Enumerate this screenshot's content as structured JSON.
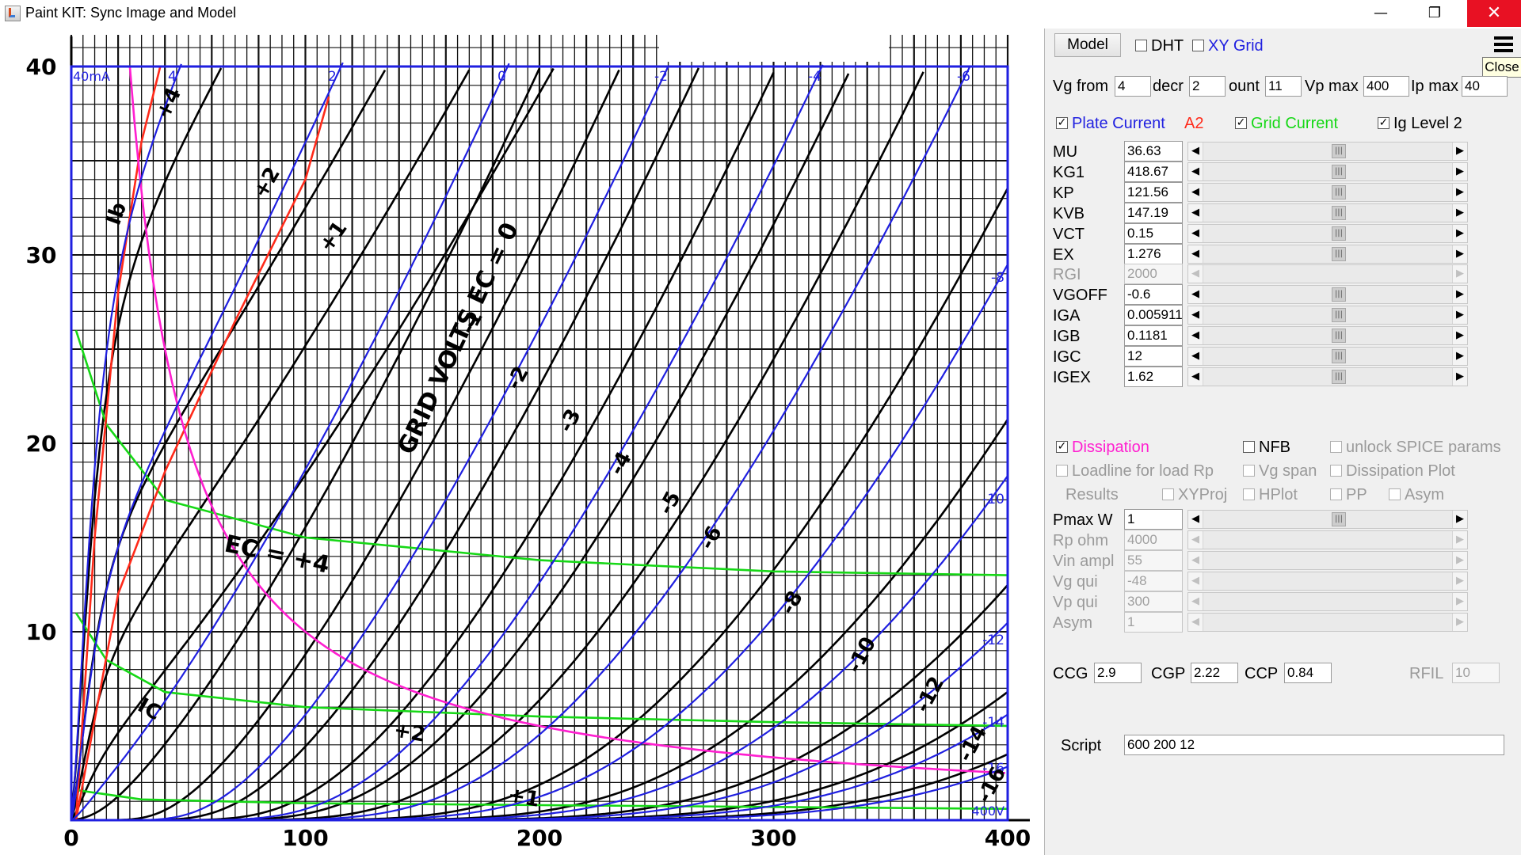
{
  "window": {
    "title": "Paint KIT: Sync Image and Model",
    "minimize_glyph": "—",
    "maximize_glyph": "❐",
    "close_glyph": "✕"
  },
  "colors": {
    "model_blue": "#1f1fe0",
    "grid_green": "#16d816",
    "a2_red": "#ff2a1a",
    "dissipation_magenta": "#ff1fd0",
    "scan_black": "#000000"
  },
  "plot": {
    "x_axis": {
      "min": 0,
      "max": 400,
      "unit": "V",
      "ticks": [
        "0",
        "100",
        "200",
        "300",
        "400"
      ]
    },
    "y_axis": {
      "min": 0,
      "max": 40,
      "unit": "mA",
      "ticks": [
        "10",
        "20",
        "30",
        "40"
      ]
    },
    "top_left_label": "40mA",
    "bottom_right_label": "400V",
    "scan_annotations": [
      "GRID VOLTS EC = 0",
      "EC = +4",
      "+2",
      "+1",
      "IC",
      "Ib",
      "+4",
      "+2",
      "+1"
    ],
    "model_curve_labels_top": [
      "4",
      "2",
      "0",
      "-2",
      "-4",
      "-6"
    ],
    "model_curve_labels_right": [
      "-8",
      "-10",
      "-12",
      "-14",
      "-16"
    ],
    "scan_curve_labels": [
      "-1",
      "-2",
      "-3",
      "-4",
      "-5",
      "-6",
      "-8",
      "-10",
      "-12",
      "-14",
      "-16"
    ]
  },
  "chart_data": {
    "type": "line",
    "xlabel": "",
    "ylabel": "",
    "xlim": [
      0,
      400
    ],
    "ylim": [
      0,
      40
    ],
    "grid": true,
    "model_params": {
      "mu": 36.63,
      "kg1": 418.67,
      "kp": 121.56,
      "kvb": 147.19,
      "ex": 1.276,
      "vct": 0.15
    },
    "plate_current_vg": [
      4,
      2,
      0,
      -2,
      -4,
      -6,
      -8,
      -10,
      -12,
      -14,
      -16
    ],
    "series": [
      {
        "name": "Vg 4",
        "kind": "plate",
        "vg": 4
      },
      {
        "name": "Vg 2",
        "kind": "plate",
        "vg": 2
      },
      {
        "name": "Vg 0",
        "kind": "plate",
        "vg": 0
      },
      {
        "name": "Vg -2",
        "kind": "plate",
        "vg": -2
      },
      {
        "name": "Vg -4",
        "kind": "plate",
        "vg": -4
      },
      {
        "name": "Vg -6",
        "kind": "plate",
        "vg": -6
      },
      {
        "name": "Vg -8",
        "kind": "plate",
        "vg": -8
      },
      {
        "name": "Vg -10",
        "kind": "plate",
        "vg": -10
      },
      {
        "name": "Vg -12",
        "kind": "plate",
        "vg": -12
      },
      {
        "name": "Vg -14",
        "kind": "plate",
        "vg": -14
      },
      {
        "name": "Vg -16",
        "kind": "plate",
        "vg": -16
      }
    ],
    "grid_current_curves": [
      {
        "vg": 4,
        "points": [
          [
            2,
            26
          ],
          [
            15,
            21
          ],
          [
            40,
            17
          ],
          [
            100,
            15
          ],
          [
            200,
            13.8
          ],
          [
            300,
            13.2
          ],
          [
            400,
            13
          ]
        ]
      },
      {
        "vg": 2,
        "points": [
          [
            2,
            11
          ],
          [
            15,
            8.5
          ],
          [
            40,
            6.8
          ],
          [
            100,
            6
          ],
          [
            200,
            5.5
          ],
          [
            300,
            5.2
          ],
          [
            400,
            5
          ]
        ]
      },
      {
        "vg": 0,
        "points": [
          [
            2,
            1.6
          ],
          [
            30,
            1.1
          ],
          [
            100,
            0.9
          ],
          [
            200,
            0.8
          ],
          [
            300,
            0.7
          ],
          [
            400,
            0.6
          ]
        ]
      }
    ],
    "a2_curves": [
      {
        "vg": 4,
        "points": [
          [
            2,
            0
          ],
          [
            10,
            15
          ],
          [
            20,
            28
          ],
          [
            30,
            36
          ],
          [
            38,
            40
          ]
        ]
      },
      {
        "vg": 2,
        "points": [
          [
            2,
            0
          ],
          [
            20,
            12
          ],
          [
            40,
            18.5
          ],
          [
            70,
            26.5
          ],
          [
            100,
            34
          ],
          [
            110,
            38.4
          ]
        ]
      }
    ],
    "dissipation_pmax_w": 1
  },
  "panel": {
    "model_button": "Model",
    "dht_label": "DHT",
    "xy_grid_label": "XY Grid",
    "close_tooltip": "Close",
    "vg_from_label": "Vg from",
    "vg_from_value": "4",
    "decr_label": "decr",
    "decr_value": "2",
    "count_label": "ount",
    "count_value": "11",
    "vp_max_label": "Vp max",
    "vp_max_value": "400",
    "ip_max_label": "Ip max",
    "ip_max_value": "40",
    "plate_current_label": "Plate Current",
    "a2_label": "A2",
    "grid_current_label": "Grid Current",
    "ig_level_label": "Ig Level 2",
    "params": [
      {
        "name": "MU",
        "value": "36.63"
      },
      {
        "name": "KG1",
        "value": "418.67"
      },
      {
        "name": "KP",
        "value": "121.56"
      },
      {
        "name": "KVB",
        "value": "147.19"
      },
      {
        "name": "VCT",
        "value": "0.15"
      },
      {
        "name": "EX",
        "value": "1.276"
      },
      {
        "name": "RGI",
        "value": "2000"
      },
      {
        "name": "VGOFF",
        "value": "-0.6"
      },
      {
        "name": "IGA",
        "value": "0.005911"
      },
      {
        "name": "IGB",
        "value": "0.1181"
      },
      {
        "name": "IGC",
        "value": "12"
      },
      {
        "name": "IGEX",
        "value": "1.62"
      }
    ],
    "dissipation_label": "Dissipation",
    "nfb_label": "NFB",
    "unlock_spice_label": "unlock SPICE params",
    "loadline_label": "Loadline for load Rp",
    "vg_span_label": "Vg span",
    "dissipation_plot_label": "Dissipation Plot",
    "results_label": "Results",
    "xyproj_label": "XYProj",
    "hplot_label": "HPlot",
    "pp_label": "PP",
    "asym_check_label": "Asym",
    "settings": [
      {
        "name": "Pmax W",
        "value": "1"
      },
      {
        "name": "Rp ohm",
        "value": "4000"
      },
      {
        "name": "Vin ampl",
        "value": "55"
      },
      {
        "name": "Vg qui",
        "value": "-48"
      },
      {
        "name": "Vp qui",
        "value": "300"
      },
      {
        "name": "Asym",
        "value": "1"
      }
    ],
    "ccg_label": "CCG",
    "ccg_value": "2.9",
    "cgp_label": "CGP",
    "cgp_value": "2.22",
    "ccp_label": "CCP",
    "ccp_value": "0.84",
    "rfil_label": "RFIL",
    "rfil_value": "10",
    "script_label": "Script",
    "script_value": "600 200 12"
  }
}
